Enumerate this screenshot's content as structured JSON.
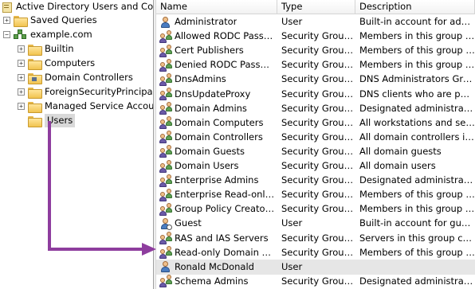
{
  "tree": {
    "root_label": "Active Directory Users and Comput",
    "saved_queries": "Saved Queries",
    "domain": "example.com",
    "children": [
      {
        "label": "Builtin",
        "kind": "folder",
        "expander": "+"
      },
      {
        "label": "Computers",
        "kind": "folder",
        "expander": "+"
      },
      {
        "label": "Domain Controllers",
        "kind": "ou",
        "expander": "+"
      },
      {
        "label": "ForeignSecurityPrincipals",
        "kind": "folder",
        "expander": "+"
      },
      {
        "label": "Managed Service Accounts",
        "kind": "folder",
        "expander": "+"
      },
      {
        "label": "Users",
        "kind": "folder",
        "expander": "",
        "selected": true
      }
    ]
  },
  "list": {
    "columns": {
      "name": "Name",
      "type": "Type",
      "description": "Description"
    },
    "rows": [
      {
        "name": "Administrator",
        "type": "User",
        "description": "Built-in account for admini...",
        "icon": "user-icon"
      },
      {
        "name": "Allowed RODC Passwor...",
        "type": "Security Group ...",
        "description": "Members in this group can...",
        "icon": "group-icon"
      },
      {
        "name": "Cert Publishers",
        "type": "Security Group ...",
        "description": "Members of this group are...",
        "icon": "group-icon"
      },
      {
        "name": "Denied RODC Password...",
        "type": "Security Group ...",
        "description": "Members in this group can...",
        "icon": "group-icon"
      },
      {
        "name": "DnsAdmins",
        "type": "Security Group ...",
        "description": "DNS Administrators Group",
        "icon": "group-icon"
      },
      {
        "name": "DnsUpdateProxy",
        "type": "Security Group ...",
        "description": "DNS clients who are permi...",
        "icon": "group-icon"
      },
      {
        "name": "Domain Admins",
        "type": "Security Group ...",
        "description": "Designated administrators...",
        "icon": "group-icon"
      },
      {
        "name": "Domain Computers",
        "type": "Security Group ...",
        "description": "All workstations and serve...",
        "icon": "group-icon"
      },
      {
        "name": "Domain Controllers",
        "type": "Security Group ...",
        "description": "All domain controllers in th...",
        "icon": "group-icon"
      },
      {
        "name": "Domain Guests",
        "type": "Security Group ...",
        "description": "All domain guests",
        "icon": "group-icon"
      },
      {
        "name": "Domain Users",
        "type": "Security Group ...",
        "description": "All domain users",
        "icon": "group-icon"
      },
      {
        "name": "Enterprise Admins",
        "type": "Security Group ...",
        "description": "Designated administrators...",
        "icon": "group-icon"
      },
      {
        "name": "Enterprise Read-only D...",
        "type": "Security Group ...",
        "description": "Members of this group are...",
        "icon": "group-icon"
      },
      {
        "name": "Group Policy Creator O...",
        "type": "Security Group ...",
        "description": "Members in this group can...",
        "icon": "group-icon"
      },
      {
        "name": "Guest",
        "type": "User",
        "description": "Built-in account for guest ...",
        "icon": "disabled-user-icon"
      },
      {
        "name": "RAS and IAS Servers",
        "type": "Security Group ...",
        "description": "Servers in this group can ...",
        "icon": "group-icon"
      },
      {
        "name": "Read-only Domain Cont...",
        "type": "Security Group ...",
        "description": "Members of this group are...",
        "icon": "group-icon"
      },
      {
        "name": "Ronald McDonald",
        "type": "User",
        "description": "",
        "icon": "user-icon",
        "selected": true
      },
      {
        "name": "Schema Admins",
        "type": "Security Group ...",
        "description": "Designated administrators...",
        "icon": "group-icon"
      }
    ]
  },
  "annotation": {
    "color": "#8e3d9e"
  }
}
